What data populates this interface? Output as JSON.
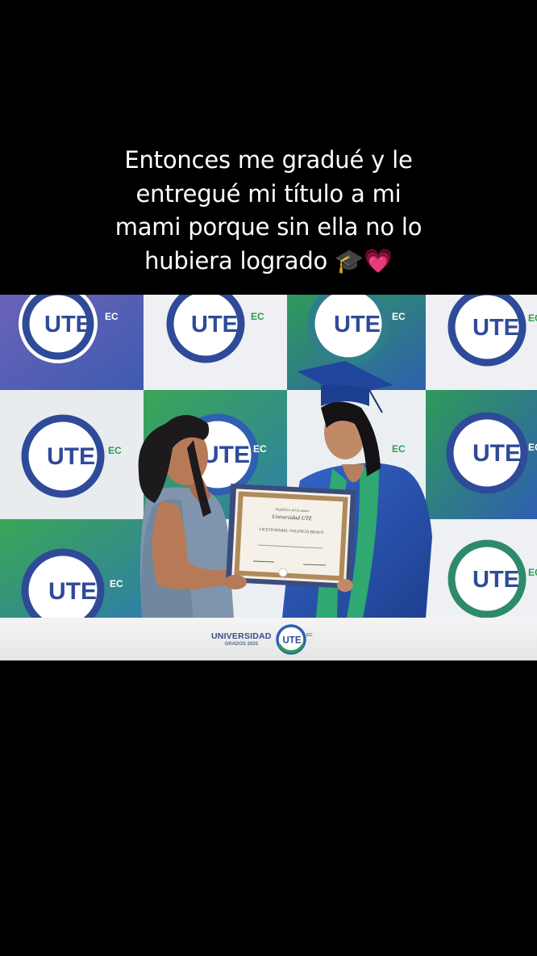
{
  "caption": {
    "lines": [
      "Entonces me gradué y le",
      "entregué mi título a mi",
      "mami porque sin ella no lo",
      "hubiera logrado 🎓💗"
    ]
  },
  "backdrop": {
    "logo_text": "UTE",
    "logo_suffix": "EC"
  },
  "diploma": {
    "header": "República del Ecuador",
    "institution": "Universidad UTE",
    "name": "LICETH MABEL VALENCIA BRAVO"
  },
  "footer": {
    "university": "UNIVERSIDAD",
    "grados": "GRADOS 2025",
    "logo_text": "UTE",
    "logo_suffix": "EC"
  },
  "colors": {
    "ute_blue": "#2f4a98",
    "ute_green": "#2e9b4f",
    "gown_blue": "#2a56b8",
    "stole_green": "#2fa871"
  }
}
